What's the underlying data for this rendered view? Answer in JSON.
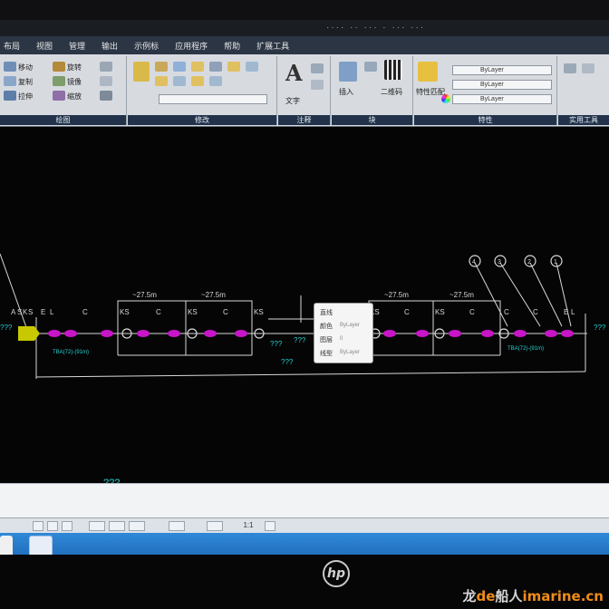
{
  "window": {
    "title_hint": "···· ·· ··· · ··· ···"
  },
  "menu": {
    "items": [
      "布局",
      "视图",
      "管理",
      "输出",
      "示例标",
      "应用程序",
      "帮助",
      "扩展工具"
    ]
  },
  "ribbon": {
    "panels": [
      {
        "title": "绘图"
      },
      {
        "title": "修改"
      },
      {
        "title": "注释"
      },
      {
        "title": "块"
      },
      {
        "title": "特性"
      },
      {
        "title": "实用工具"
      }
    ],
    "draw_tools": [
      "移动",
      "复制",
      "拉伸",
      "旋转",
      "镜像",
      "缩放"
    ],
    "text_label": "文字",
    "insert_label": "插入",
    "qrcode_label": "二维码",
    "match_label": "特性匹配",
    "bylayer_values": [
      "ByLayer",
      "ByLayer",
      "ByLayer"
    ],
    "color_theme": {
      "ribbon_bg": "#d7dbe0",
      "panel_title_bg": "#22324a",
      "menu_bg": "#2b3544"
    }
  },
  "drawing": {
    "segment_labels": [
      "C",
      "C",
      "C",
      "C",
      "C",
      "C",
      "C"
    ],
    "ks_labels": [
      "KS",
      "KS",
      "KS",
      "KS",
      "KS"
    ],
    "spacing_labels": [
      "~27.5m",
      "~27.5m",
      "~27.5m",
      "~27.5m"
    ],
    "left_marks": [
      "A",
      "S",
      "K",
      "S",
      "E",
      "L"
    ],
    "right_marks": [
      "E",
      "L"
    ],
    "callouts": [
      "4",
      "3",
      "2",
      "1"
    ],
    "unknown_labels": [
      "???",
      "???",
      "???"
    ],
    "cyan_caption_left": "TBA(72)-(91m)",
    "cyan_caption_right": "TBA(72)-(91m)",
    "cyan_arrow_left": "???",
    "cyan_arrow_right": "???",
    "bottom_text": "???",
    "colors": {
      "line": "#d8d8d8",
      "segment": "#c815c8",
      "cyan": "#25d0d0",
      "yellow": "#e0e000"
    }
  },
  "properties_popup": {
    "title": "直线",
    "rows": [
      {
        "label": "颜色",
        "value": "ByLayer"
      },
      {
        "label": "图层",
        "value": "0"
      },
      {
        "label": "线型",
        "value": "ByLayer"
      }
    ]
  },
  "statusbar": {
    "scale": "1:1"
  },
  "watermark": {
    "part1": "龙",
    "part2": "de",
    "part3": "船人",
    "part4": "imarine.cn"
  },
  "brand": "hp"
}
